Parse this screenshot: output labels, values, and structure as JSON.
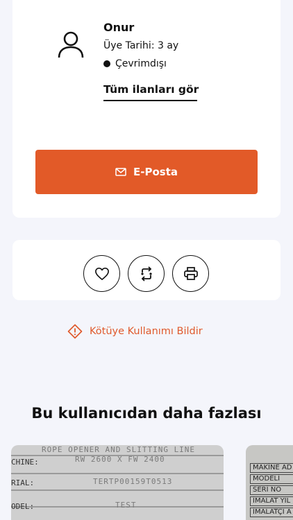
{
  "seller": {
    "name": "Onur",
    "member_since": "Üye Tarihi: 3 ay",
    "status": "Çevrimdışı",
    "all_listings_link": "Tüm ilanları gör",
    "email_button": "E-Posta"
  },
  "actions": {
    "favorite_icon": "heart-icon",
    "compare_icon": "compare-arrows-icon",
    "print_icon": "printer-icon"
  },
  "report": {
    "label": "Kötüye Kullanımı Bildir",
    "icon": "warning-icon",
    "color": "#e05a2d"
  },
  "more_from_user": {
    "title": "Bu kullanıcıdan daha fazlası",
    "items": [
      {
        "plate_lines": [
          "ROPE OPENER AND SLITTING LINE",
          "CHINE:",
          "RW 2600 X FW 2400",
          "RIAL:",
          "TERTP00159T0513",
          "ODEL:",
          "TEST"
        ]
      },
      {
        "plate_lines": [
          "MAKİNE AD",
          "MODELİ",
          "SERİ NO",
          "İMALAT YIL",
          "İMALATÇI A"
        ]
      }
    ]
  },
  "colors": {
    "accent": "#e25a28",
    "background": "#f4f5fb"
  }
}
